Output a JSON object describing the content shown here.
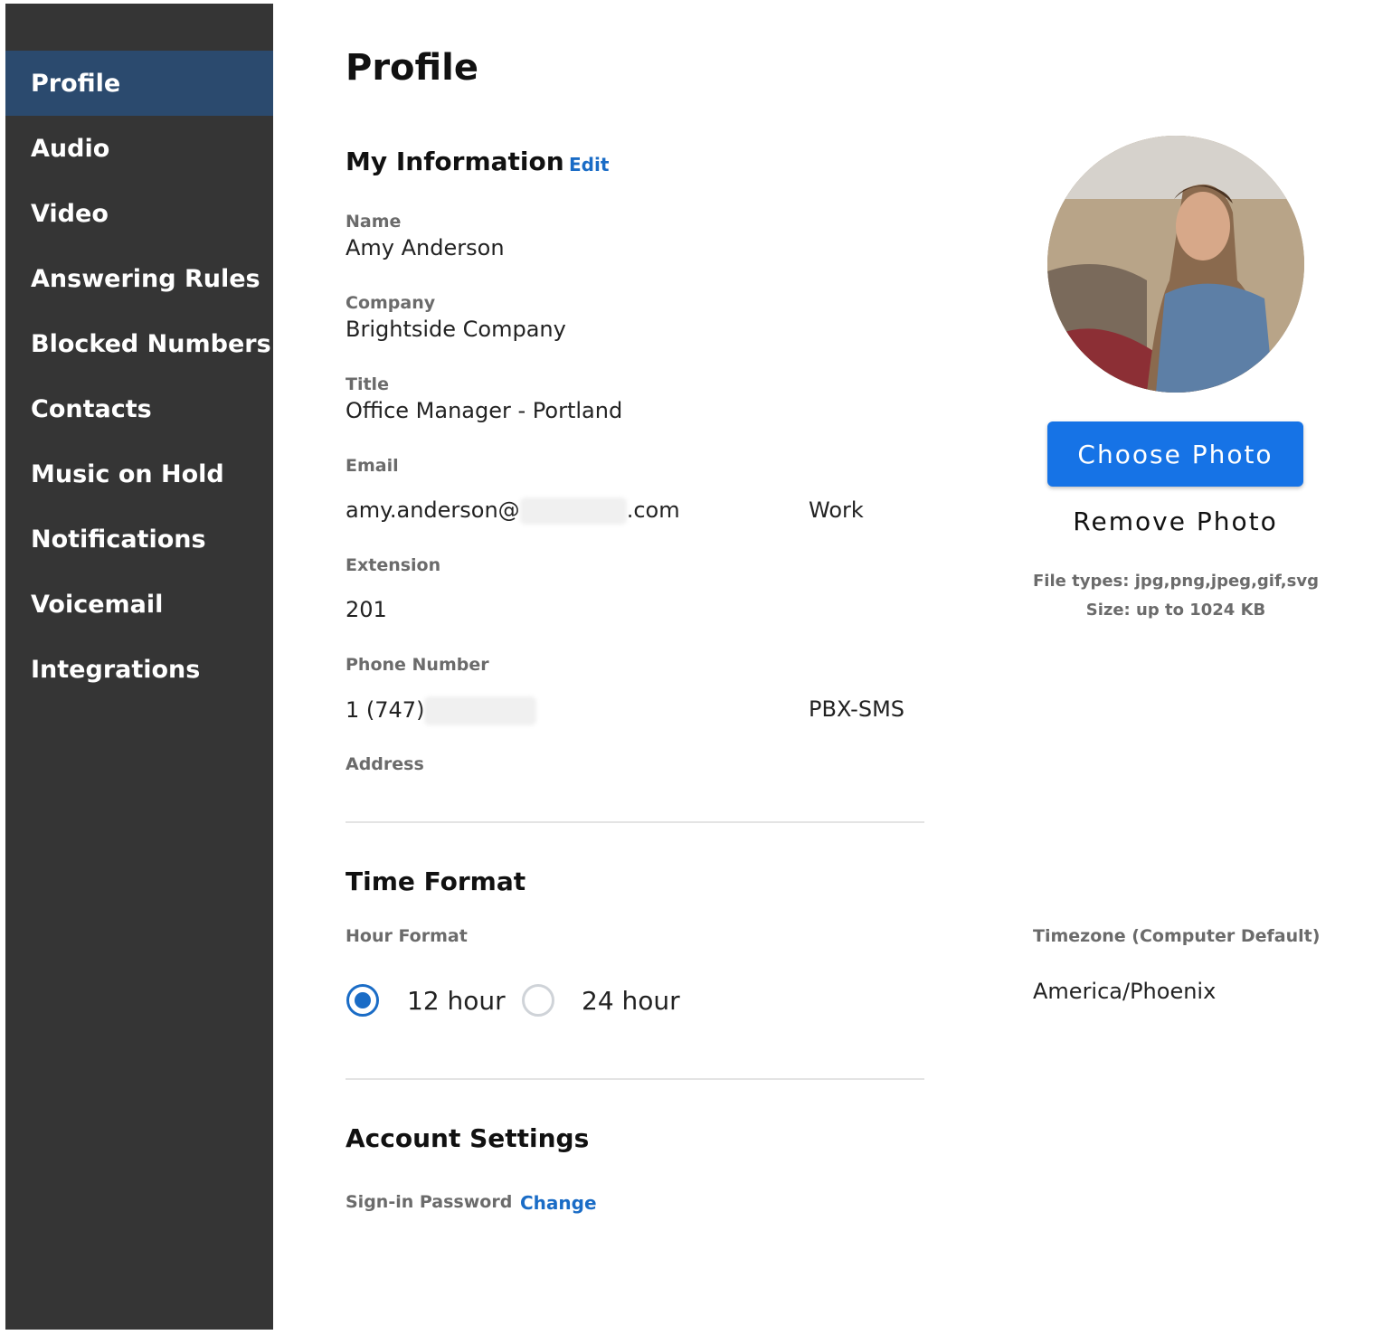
{
  "sidebar": {
    "items": [
      {
        "label": "Profile",
        "active": true
      },
      {
        "label": "Audio"
      },
      {
        "label": "Video"
      },
      {
        "label": "Answering Rules"
      },
      {
        "label": "Blocked Numbers"
      },
      {
        "label": "Contacts"
      },
      {
        "label": "Music on Hold"
      },
      {
        "label": "Notifications"
      },
      {
        "label": "Voicemail"
      },
      {
        "label": "Integrations"
      }
    ]
  },
  "page": {
    "title": "Profile"
  },
  "my_information": {
    "heading": "My Information",
    "edit_label": "Edit",
    "name_label": "Name",
    "name_value": "Amy Anderson",
    "company_label": "Company",
    "company_value": "Brightside Company",
    "title_label": "Title",
    "title_value": "Office Manager - Portland",
    "email_label": "Email",
    "email_prefix": "amy.anderson@",
    "email_suffix": ".com",
    "email_type": "Work",
    "extension_label": "Extension",
    "extension_value": "201",
    "phone_label": "Phone Number",
    "phone_prefix": "1 (747)",
    "phone_type": "PBX-SMS",
    "address_label": "Address"
  },
  "photo": {
    "choose_label": "Choose Photo",
    "remove_label": "Remove Photo",
    "file_types": "File types: jpg,png,jpeg,gif,svg",
    "size_limit": "Size: up to 1024 KB"
  },
  "time_format": {
    "heading": "Time Format",
    "hour_format_label": "Hour Format",
    "option_12": "12 hour",
    "option_24": "24 hour",
    "selected": "12 hour",
    "timezone_label": "Timezone (Computer Default)",
    "timezone_value": "America/Phoenix"
  },
  "account_settings": {
    "heading": "Account Settings",
    "password_label": "Sign-in Password",
    "change_label": "Change"
  },
  "colors": {
    "sidebar_bg": "#353535",
    "sidebar_active": "#2b4a6e",
    "accent": "#1673e6",
    "link": "#1a6cc6"
  }
}
